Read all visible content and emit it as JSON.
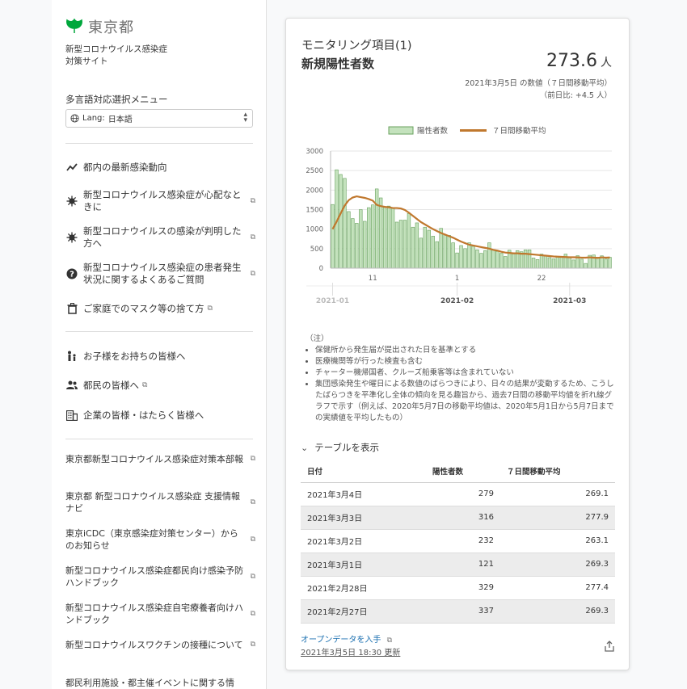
{
  "sidebar": {
    "logo_text": "東京都",
    "site_title_line1": "新型コロナウイルス感染症",
    "site_title_line2": "対策サイト",
    "lang_menu_label": "多言語対応選択メニュー",
    "lang_prefix": "Lang:",
    "lang_value": "日本語",
    "nav_items": [
      {
        "label": "都内の最新感染動向",
        "icon": "trend-icon"
      },
      {
        "label": "新型コロナウイルス感染症が心配なときに",
        "icon": "virus-icon"
      },
      {
        "label": "新型コロナウイルスの感染が判明した方へ",
        "icon": "virus-icon"
      },
      {
        "label": "新型コロナウイルス感染症の患者発生状況に関するよくあるご質問",
        "icon": "question-icon"
      },
      {
        "label": "ご家庭でのマスク等の捨て方",
        "icon": "trash-icon"
      },
      {
        "label": "お子様をお持ちの皆様へ",
        "icon": "family-icon"
      },
      {
        "label": "都民の皆様へ",
        "icon": "people-icon"
      },
      {
        "label": "企業の皆様・はたらく皆様へ",
        "icon": "building-icon"
      }
    ],
    "links": [
      "東京都新型コロナウイルス感染症対策本部報",
      "東京都 新型コロナウイルス感染症 支援情報ナビ",
      "東京iCDC（東京感染症対策センター）からのお知らせ",
      "新型コロナウイルス感染症都民向け感染予防ハンドブック",
      "新型コロナウイルス感染症自宅療養者向けハンドブック",
      "新型コロナウイルスワクチンの接種について",
      "都民利用施設・都主催イベントに関する情"
    ]
  },
  "card": {
    "title": "モニタリング項目(1)",
    "subtitle": "新規陽性者数",
    "value": "273.6",
    "unit": "人",
    "desc_line1": "2021年3月5日 の数値（７日間移動平均）",
    "desc_line2": "（前日比: +4.5 人）",
    "notes_title": "（注）",
    "notes": [
      "保健所から発生届が提出された日を基準とする",
      "医療機関等が行った検査も含む",
      "チャーター機帰国者、クルーズ船乗客等は含まれていない",
      "集団感染発生や曜日による数値のばらつきにより、日々の結果が変動するため、こうしたばらつきを平準化し全体の傾向を見る趣旨から、過去7日間の移動平均値を折れ線グラフで示す（例えば、2020年5月7日の移動平均値は、2020年5月1日から5月7日までの実績値を平均したもの）"
    ],
    "table_toggle": "テーブルを表示",
    "table_headers": [
      "日付",
      "陽性者数",
      "７日間移動平均"
    ],
    "table_rows": [
      [
        "2021年3月4日",
        "279",
        "269.1"
      ],
      [
        "2021年3月3日",
        "316",
        "277.9"
      ],
      [
        "2021年3月2日",
        "232",
        "263.1"
      ],
      [
        "2021年3月1日",
        "121",
        "269.3"
      ],
      [
        "2021年2月28日",
        "329",
        "277.4"
      ],
      [
        "2021年2月27日",
        "337",
        "269.3"
      ]
    ],
    "opendata_label": "オープンデータを入手",
    "updated_label": "2021年3月5日 18:30 更新"
  },
  "chart_data": {
    "type": "bar",
    "title": "",
    "legend": [
      "陽性者数",
      "７日間移動平均"
    ],
    "legend_position": "top",
    "bar_color": "#c4e2bd",
    "bar_border": "#68a25e",
    "line_color": "#c0782e",
    "ylim": [
      0,
      3000
    ],
    "y_ticks": [
      "0",
      "500",
      "1000",
      "1500",
      "2000",
      "2500",
      "3000"
    ],
    "x_day_ticks": [
      {
        "index": 10,
        "label": "11"
      },
      {
        "index": 31,
        "label": "1"
      },
      {
        "index": 52,
        "label": "22"
      }
    ],
    "x_month_ticks": [
      {
        "index": 0,
        "label": "2021-01"
      },
      {
        "index": 31,
        "label": "2021-02"
      },
      {
        "index": 59,
        "label": "2021-03"
      }
    ],
    "series": [
      {
        "name": "陽性者数",
        "type": "bar",
        "values": [
          1630,
          2520,
          2400,
          2300,
          1450,
          1270,
          1150,
          1500,
          1200,
          1550,
          1620,
          2030,
          1800,
          1560,
          1590,
          1550,
          1180,
          1230,
          1230,
          1400,
          1050,
          1160,
          770,
          1050,
          970,
          820,
          680,
          1020,
          850,
          840,
          650,
          390,
          580,
          500,
          650,
          560,
          470,
          380,
          450,
          650,
          480,
          430,
          380,
          300,
          460,
          370,
          450,
          420,
          470,
          470,
          260,
          220,
          360,
          330,
          270,
          240,
          290,
          300,
          360,
          280,
          210,
          320,
          230,
          121,
          329,
          337,
          279,
          316,
          232,
          279
        ]
      },
      {
        "name": "７日間移動平均",
        "type": "line",
        "values": [
          1000,
          1190,
          1400,
          1600,
          1740,
          1810,
          1840,
          1820,
          1800,
          1770,
          1730,
          1620,
          1590,
          1570,
          1560,
          1540,
          1540,
          1530,
          1490,
          1420,
          1340,
          1260,
          1180,
          1120,
          1060,
          1000,
          950,
          900,
          860,
          820,
          780,
          730,
          680,
          640,
          600,
          580,
          560,
          540,
          520,
          500,
          470,
          450,
          420,
          400,
          390,
          380,
          380,
          370,
          370,
          360,
          350,
          340,
          330,
          320,
          310,
          300,
          295,
          290,
          285,
          280,
          280,
          276,
          270,
          269.3,
          277.4,
          269.3,
          263.1,
          277.9,
          269.1,
          273.6
        ]
      }
    ]
  }
}
